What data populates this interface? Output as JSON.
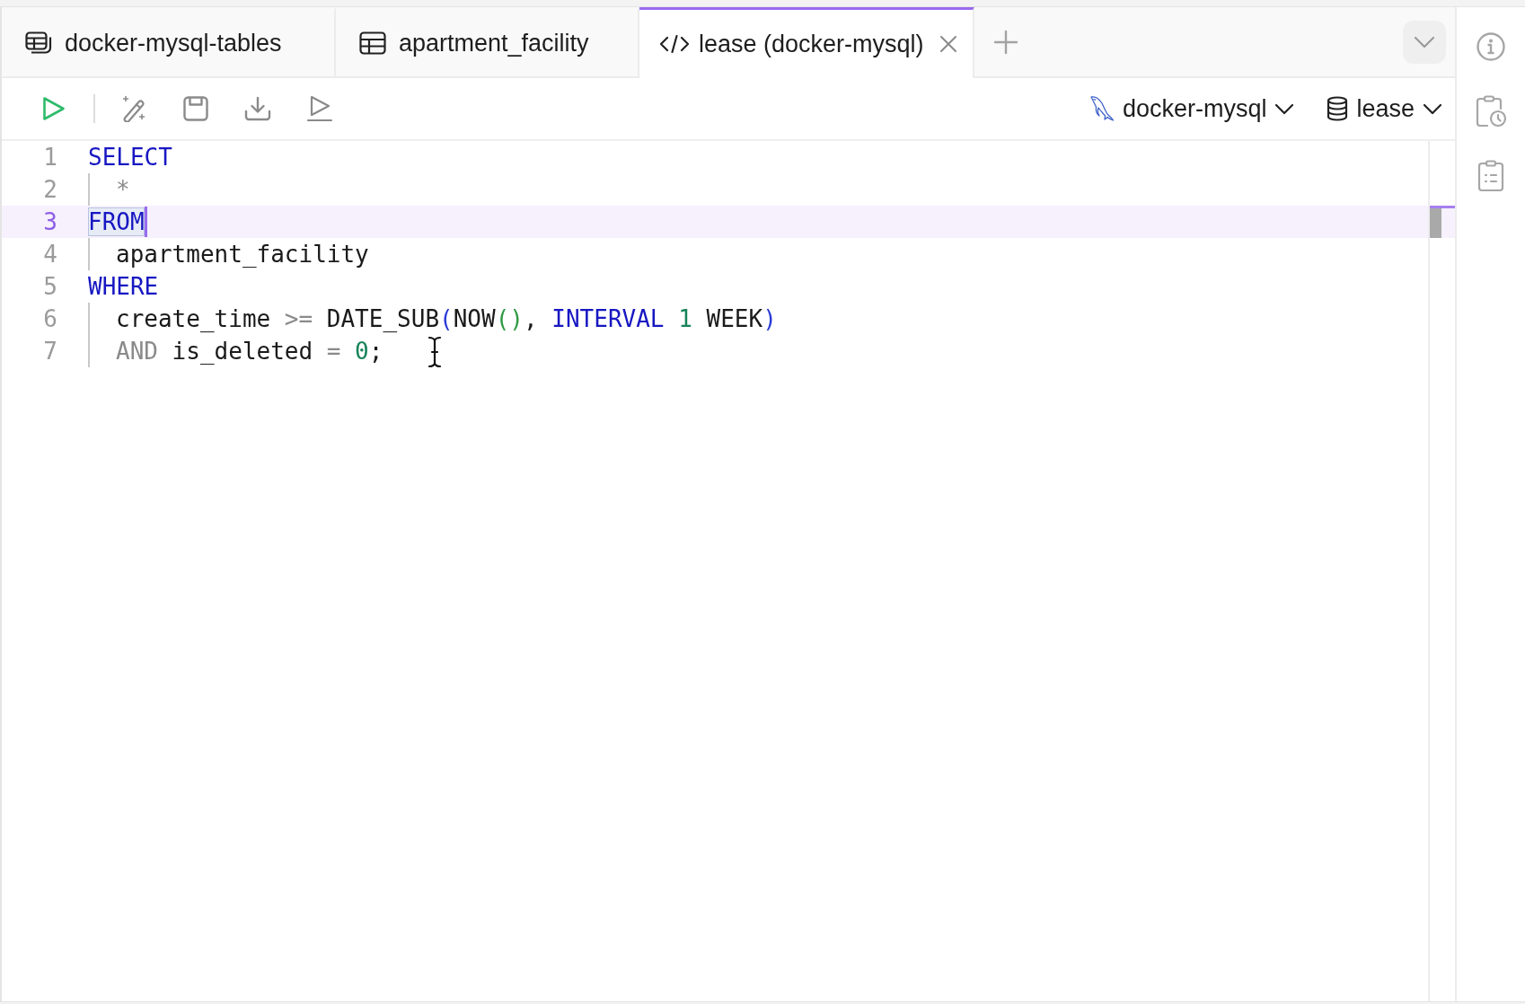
{
  "tabs": [
    {
      "label": "docker-mysql-tables",
      "kind": "tables",
      "selected": false
    },
    {
      "label": "apartment_facility",
      "kind": "table",
      "selected": false
    },
    {
      "label": "lease (docker-mysql)",
      "kind": "query",
      "selected": true
    }
  ],
  "toolbar": {
    "connection": "docker-mysql",
    "database": "lease"
  },
  "editor": {
    "lines": [
      {
        "number": "1",
        "selected": false,
        "highlighted": false,
        "tokens": [
          {
            "text": "SELECT",
            "kind": "keyword"
          }
        ],
        "children": [
          {
            "number": "2",
            "selected": false,
            "highlighted": false,
            "tokens": [
              {
                "text": "*",
                "kind": "operator"
              }
            ]
          }
        ]
      },
      {
        "number": "3",
        "selected": true,
        "highlighted": true,
        "tokens": [
          {
            "text": "FROM",
            "kind": "keyword"
          }
        ],
        "children": [
          {
            "number": "4",
            "selected": false,
            "highlighted": false,
            "tokens": [
              {
                "text": "apartment_facility",
                "kind": "plain"
              }
            ]
          }
        ]
      },
      {
        "number": "5",
        "selected": false,
        "highlighted": false,
        "tokens": [
          {
            "text": "WHERE",
            "kind": "keyword"
          }
        ],
        "children": [
          {
            "number": "6",
            "selected": false,
            "highlighted": false,
            "tokens": [
              {
                "text": "create_time ",
                "kind": "plain"
              },
              {
                "text": ">=",
                "kind": "operator"
              },
              {
                "text": " DATE_SUB",
                "kind": "plain"
              },
              {
                "text": "(",
                "kind": "paren"
              },
              {
                "text": "NOW",
                "kind": "plain"
              },
              {
                "text": "()",
                "kind": "subparen"
              },
              {
                "text": ", ",
                "kind": "plain"
              },
              {
                "text": "INTERVAL",
                "kind": "keyword"
              },
              {
                "text": " 1",
                "kind": "number"
              },
              {
                "text": " WEEK",
                "kind": "plain"
              },
              {
                "text": ")",
                "kind": "paren"
              }
            ]
          },
          {
            "number": "7",
            "selected": false,
            "highlighted": false,
            "tokens": [
              {
                "text": "AND",
                "kind": "operator"
              },
              {
                "text": " is_deleted ",
                "kind": "plain"
              },
              {
                "text": "=",
                "kind": "operator"
              },
              {
                "text": " 0",
                "kind": "number"
              },
              {
                "text": ";",
                "kind": "plain"
              }
            ]
          }
        ]
      }
    ]
  }
}
